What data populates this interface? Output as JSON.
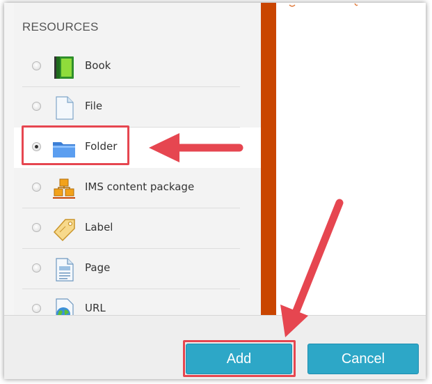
{
  "dialog": {
    "section_heading": "RESOURCES",
    "description_snippet": "g",
    "resources": [
      {
        "label": "Book",
        "icon": "book-icon",
        "selected": false
      },
      {
        "label": "File",
        "icon": "file-icon",
        "selected": false
      },
      {
        "label": "Folder",
        "icon": "folder-icon",
        "selected": true
      },
      {
        "label": "IMS content package",
        "icon": "ims-package-icon",
        "selected": false
      },
      {
        "label": "Label",
        "icon": "label-tag-icon",
        "selected": false
      },
      {
        "label": "Page",
        "icon": "page-icon",
        "selected": false
      },
      {
        "label": "URL",
        "icon": "url-globe-icon",
        "selected": false
      }
    ],
    "buttons": {
      "add": "Add",
      "cancel": "Cancel"
    }
  },
  "colors": {
    "accent_bar": "#c94500",
    "button": "#2da7c7",
    "highlight": "#e64650"
  }
}
